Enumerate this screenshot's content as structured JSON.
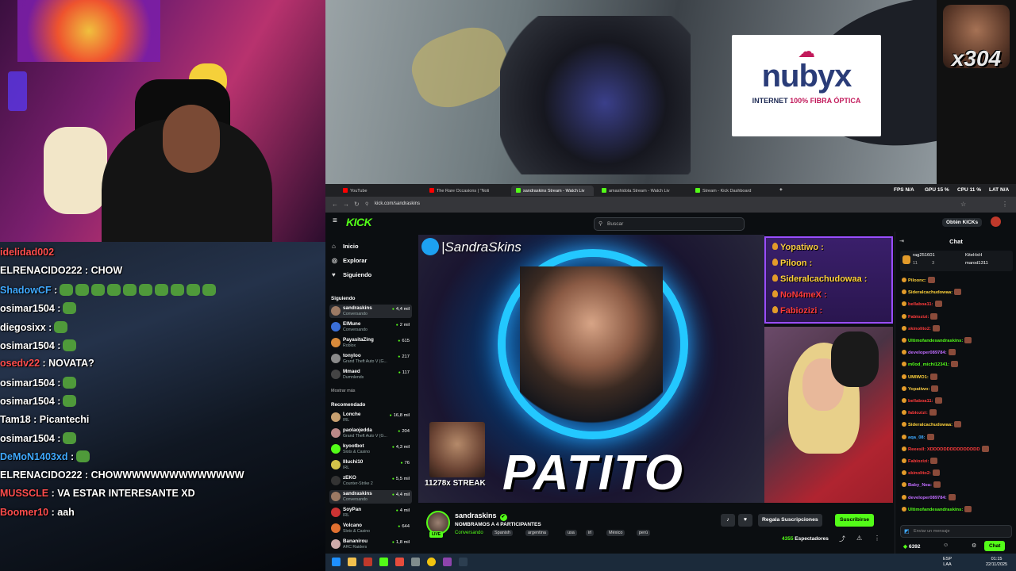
{
  "webcam": {
    "label": "streamer webcam"
  },
  "left_chat": [
    {
      "user": "idelidad002",
      "text": "",
      "color": "#ff4d4d"
    },
    {
      "user": "ELRENACIDO222",
      "text": ": CHOW",
      "color": "#ffffff"
    },
    {
      "user": "ShadowCF",
      "text": ":",
      "color": "#3fa9ff"
    },
    {
      "user": "osimar1504",
      "text": ":",
      "color": "#ffffff"
    },
    {
      "user": "diegosixx",
      "text": ":",
      "color": "#ffffff"
    },
    {
      "user": "osimar1504",
      "text": ":",
      "color": "#ffffff"
    },
    {
      "user": "osedv22",
      "text": ": NOVATA?",
      "color": "#ff4d4d"
    },
    {
      "user": "osimar1504",
      "text": ":",
      "color": "#ffffff"
    },
    {
      "user": "osimar1504",
      "text": ":",
      "color": "#ffffff"
    },
    {
      "user": "Tam18",
      "text": ": Picantechi",
      "color": "#ffffff"
    },
    {
      "user": "osimar1504",
      "text": ":",
      "color": "#ffffff"
    },
    {
      "user": "DeMoN1403xd",
      "text": ":",
      "color": "#3fa9ff"
    },
    {
      "user": "ELRENACIDO222",
      "text": ": CHOWWWWWWWWWWWWWW",
      "color": "#ffffff"
    },
    {
      "user": "MUSSCLE",
      "text": ": VA ESTAR INTERESANTE XD",
      "color": "#ff4d4d"
    },
    {
      "user": "Boomer10",
      "text": ": aah",
      "color": "#ff4d4d"
    }
  ],
  "ad": {
    "brand": "nubyx",
    "tagline_a": "INTERNET ",
    "tagline_b": "100% FIBRA ÓPTICA"
  },
  "meme": {
    "counter": "x304"
  },
  "browser": {
    "tabs": [
      {
        "title": "YouTube",
        "color": "#ff0000"
      },
      {
        "title": "The Rare Occasions | \"Noti",
        "color": "#ff0000"
      },
      {
        "title": "sandraskins Stream - Watch Liv",
        "color": "#53fc18"
      },
      {
        "title": "amashidota Stream - Watch Liv",
        "color": "#53fc18"
      },
      {
        "title": "Stream - Kick Dashboard",
        "color": "#53fc18"
      }
    ],
    "new_tab": "+",
    "stats": {
      "fps": "FPS N/A",
      "gpu": "GPU 15 %",
      "cpu": "CPU 11 %",
      "lat": "LAT N/A"
    },
    "url": "kick.com/sandraskins"
  },
  "kick": {
    "logo": "KICK",
    "search_placeholder": "Buscar",
    "get_kicks": "Obtén KICKs",
    "nav": [
      {
        "label": "Inicio",
        "icon": "⌂"
      },
      {
        "label": "Explorar",
        "icon": "◎"
      },
      {
        "label": "Siguiendo",
        "icon": "♥"
      }
    ],
    "following_title": "Siguiendo",
    "following": [
      {
        "name": "sandraskins",
        "cat": "Conversando",
        "viewers": "4,4 mil",
        "color": "#9c7a64"
      },
      {
        "name": "ElMune",
        "cat": "Conversando",
        "viewers": "2 mil",
        "color": "#3a6fd8"
      },
      {
        "name": "PayasitaZing",
        "cat": "Roblox",
        "viewers": "615",
        "color": "#d88a3a"
      },
      {
        "name": "tonyloo",
        "cat": "Grand Theft Auto V (G...",
        "viewers": "217",
        "color": "#8a8a8a"
      },
      {
        "name": "Mmaed",
        "cat": "Dumnlends",
        "viewers": "117",
        "color": "#444"
      }
    ],
    "show_more": "Mostrar más",
    "recommended_title": "Recomendado",
    "recommended": [
      {
        "name": "Lonche",
        "cat": "IRL",
        "viewers": "16,8 mil",
        "color": "#c8a070"
      },
      {
        "name": "paolaojedda",
        "cat": "Grand Theft Auto V (G...",
        "viewers": "204",
        "color": "#b88"
      },
      {
        "name": "kyootbot",
        "cat": "Slots & Casino",
        "viewers": "4,3 mil",
        "color": "#53fc18"
      },
      {
        "name": "Illuchi10",
        "cat": "IRL",
        "viewers": "76",
        "color": "#d4c24a"
      },
      {
        "name": "zEKO",
        "cat": "Counter-Strike 2",
        "viewers": "5,5 mil",
        "color": "#333"
      },
      {
        "name": "sandraskins",
        "cat": "Conversando",
        "viewers": "4,4 mil",
        "color": "#9c7a64"
      },
      {
        "name": "SoyPan",
        "cat": "IRL",
        "viewers": "4 mil",
        "color": "#c33"
      },
      {
        "name": "Volcano",
        "cat": "Slots & Casino",
        "viewers": "644",
        "color": "#e07030"
      },
      {
        "name": "Bananirou",
        "cat": "ARC Raiders",
        "viewers": "1,8 mil",
        "color": "#caa"
      }
    ]
  },
  "overlay": {
    "twitter_handle": "|SandraSkins",
    "title_text": "PATITO",
    "streak": "11278x STREAK"
  },
  "overlay_chat": [
    {
      "user": "Yopatiwo :",
      "color": "#f5c842"
    },
    {
      "user": "Piloon :",
      "color": "#ffd23a"
    },
    {
      "user": "Sideralcachudowaa :",
      "color": "#ffd23a"
    },
    {
      "user": "NoN4meX :",
      "color": "#ff3b3b"
    },
    {
      "user": "Fabiozizi :",
      "color": "#ff3b3b"
    }
  ],
  "stream": {
    "name": "sandraskins",
    "title": "NOMBRAMOS A 4 PARTICIPANTES",
    "category": "Conversando",
    "tags": [
      "Spanish",
      "argentina",
      "usa",
      "irl",
      "México",
      "perú"
    ],
    "gift_label": "Regala Suscripciones",
    "subscribe_label": "Suscribirse",
    "viewers_num": "4355",
    "viewers_label": "Espectadores",
    "live_label": "LIVE"
  },
  "kick_chat": {
    "title": "Chat",
    "pinned_a": "rag251601",
    "pinned_b": "KiteHxH",
    "pinned_c": "marod1311",
    "pinned_d": "11",
    "pinned_e": "3",
    "messages": [
      {
        "user": "Piloonc:",
        "color": "#ffd23a"
      },
      {
        "user": "Sideralcachudowaa:",
        "color": "#ffd23a"
      },
      {
        "user": "bellaboa11:",
        "color": "#ff3b3b"
      },
      {
        "user": "Fabiozizi:",
        "color": "#ff3b3b"
      },
      {
        "user": "skinolito2:",
        "color": "#ff3b3b"
      },
      {
        "user": "Ultimofandesandraskins:",
        "color": "#53fc18"
      },
      {
        "user": "developer089784:",
        "color": "#c06cff"
      },
      {
        "user": "m0od_michi12341:",
        "color": "#53fc18"
      },
      {
        "user": "UMIWO1:",
        "color": "#ffd23a"
      },
      {
        "user": "Yopatiwo:",
        "color": "#f5c842"
      },
      {
        "user": "bellaboa11:",
        "color": "#ff3b3b"
      },
      {
        "user": "fabiozizi:",
        "color": "#ff3b3b"
      },
      {
        "user": "Sideralcachudowaa:",
        "color": "#ffd23a"
      },
      {
        "user": "aqa_08:",
        "color": "#3fa9ff"
      },
      {
        "user": "Reeesll: XDDDDDDDDDDDDDDD",
        "color": "#ff3b3b"
      },
      {
        "user": "Fabiozizi:",
        "color": "#ff3b3b"
      },
      {
        "user": "skinolito2:",
        "color": "#ff3b3b"
      },
      {
        "user": "Baby_Nea:",
        "color": "#c06cff"
      },
      {
        "user": "developer089784:",
        "color": "#c06cff"
      },
      {
        "user": "Ultimofandesandraskins:",
        "color": "#53fc18"
      }
    ],
    "input_placeholder": "Enviar un mensaje",
    "kicks_count": "6392",
    "chat_button": "Chat"
  },
  "taskbar": {
    "lang_a": "ESP",
    "lang_b": "LAA",
    "time": "01:15",
    "date": "22/11/2025"
  }
}
